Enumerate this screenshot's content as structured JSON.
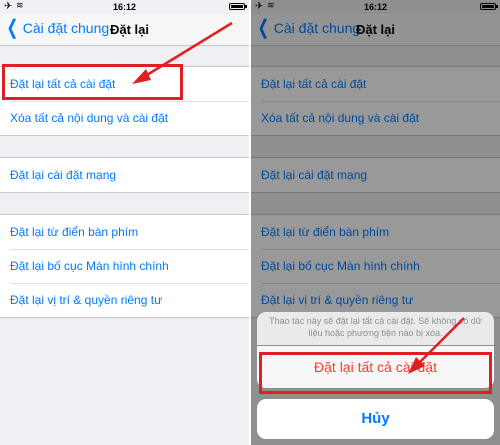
{
  "status_bar": {
    "time": "16:12",
    "airplane_icon": "airplane-icon",
    "wifi_icon": "wifi-icon",
    "battery_icon": "battery-icon"
  },
  "left": {
    "nav": {
      "back_label": "Cài đặt chung",
      "title": "Đặt lại"
    },
    "group1": [
      "Đặt lại tất cả cài đặt",
      "Xóa tất cả nội dung và cài đặt"
    ],
    "group2": [
      "Đặt lại cài đặt mạng"
    ],
    "group3": [
      "Đặt lại từ điển bàn phím",
      "Đặt lại bố cục Màn hình chính",
      "Đặt lại vị trí & quyền riêng tư"
    ]
  },
  "right": {
    "nav": {
      "back_label": "Cài đặt chung",
      "title": "Đặt lại"
    },
    "group1": [
      "Đặt lại tất cả cài đặt",
      "Xóa tất cả nội dung và cài đặt"
    ],
    "group2": [
      "Đặt lại cài đặt mạng"
    ],
    "group3": [
      "Đặt lại từ điển bàn phím",
      "Đặt lại bố cục Màn hình chính",
      "Đặt lại vị trí & quyền riêng tư"
    ],
    "sheet": {
      "message": "Thao tác này sẽ đặt lại tất cả cài đặt. Sẽ không có dữ liệu hoặc phương tiện nào bị xóa.",
      "action": "Đặt lại tất cả cài đặt",
      "cancel": "Hủy"
    }
  },
  "colors": {
    "accent": "#007aff",
    "destructive": "#ff3b30",
    "annotation": "#e02020"
  }
}
